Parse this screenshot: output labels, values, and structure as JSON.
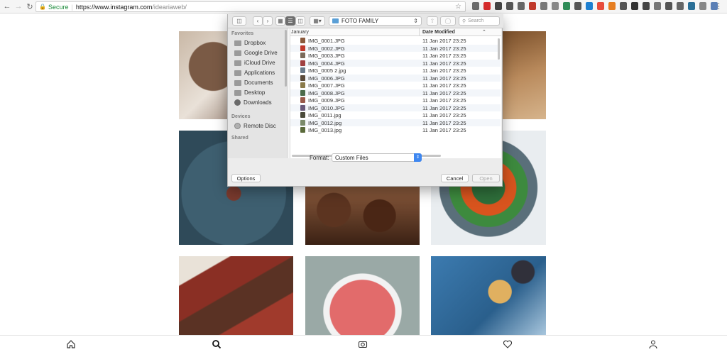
{
  "browser": {
    "secure_label": "Secure",
    "url_host": "https://www.instagram.com",
    "url_path": "/ideariaweb/"
  },
  "file_dialog": {
    "current_folder": "FOTO FAMILY",
    "search_placeholder": "Search",
    "sidebar": {
      "favorites_title": "Favorites",
      "favorites": [
        "Dropbox",
        "Google Drive",
        "iCloud Drive",
        "Applications",
        "Documents",
        "Desktop",
        "Downloads"
      ],
      "devices_title": "Devices",
      "devices": [
        "Remote Disc"
      ],
      "shared_title": "Shared"
    },
    "list": {
      "name_header": "January",
      "date_header": "Date Modified",
      "rows": [
        {
          "name": "IMG_0001.JPG",
          "date": "11 Jan 2017 23:25"
        },
        {
          "name": "IMG_0002.JPG",
          "date": "11 Jan 2017 23:25"
        },
        {
          "name": "IMG_0003.JPG",
          "date": "11 Jan 2017 23:25"
        },
        {
          "name": "IMG_0004.JPG",
          "date": "11 Jan 2017 23:25"
        },
        {
          "name": "IMG_0005 2.jpg",
          "date": "11 Jan 2017 23:25"
        },
        {
          "name": "IMG_0006.JPG",
          "date": "11 Jan 2017 23:25"
        },
        {
          "name": "IMG_0007.JPG",
          "date": "11 Jan 2017 23:25"
        },
        {
          "name": "IMG_0008.JPG",
          "date": "11 Jan 2017 23:25"
        },
        {
          "name": "IMG_0009.JPG",
          "date": "11 Jan 2017 23:25"
        },
        {
          "name": "IMG_0010.JPG",
          "date": "11 Jan 2017 23:25"
        },
        {
          "name": "IMG_0011.jpg",
          "date": "11 Jan 2017 23:25"
        },
        {
          "name": "IMG_0012.jpg",
          "date": "11 Jan 2017 23:25"
        },
        {
          "name": "IMG_0013.jpg",
          "date": "11 Jan 2017 23:25"
        }
      ]
    },
    "format_label": "Format:",
    "format_value": "Custom Files",
    "options_label": "Options",
    "cancel_label": "Cancel",
    "open_label": "Open"
  },
  "colors": {
    "secure_green": "#1a8a3a",
    "select_blue": "#3e87f0",
    "folder_blue": "#5a9fd6"
  }
}
